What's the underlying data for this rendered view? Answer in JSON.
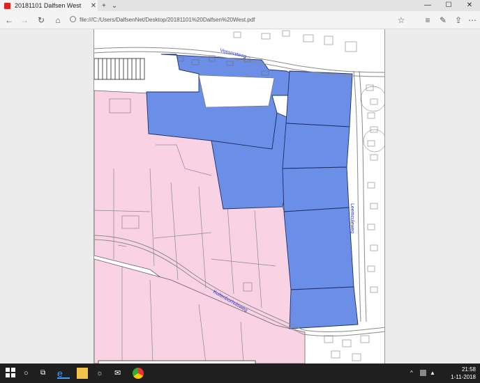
{
  "tab": {
    "title": "20181101 Dalfsen West"
  },
  "window_controls": {
    "minimize": "—",
    "maximize": "☐",
    "close": "✕"
  },
  "address": {
    "url": "file:///C:/Users/DalfsenNet/Desktop/20181101%20Dalfsen%20West.pdf"
  },
  "map": {
    "streets": [
      "Vossersteeg",
      "Leemculeweg",
      "Kuitenborhuisweg"
    ],
    "colors": {
      "blue": "#6b8fe6",
      "pink": "#f9d2e4",
      "line": "#8a8a8a",
      "street_text": "#2233cc"
    }
  },
  "taskbar": {
    "time": "21:58",
    "date": "1-11-2018"
  }
}
